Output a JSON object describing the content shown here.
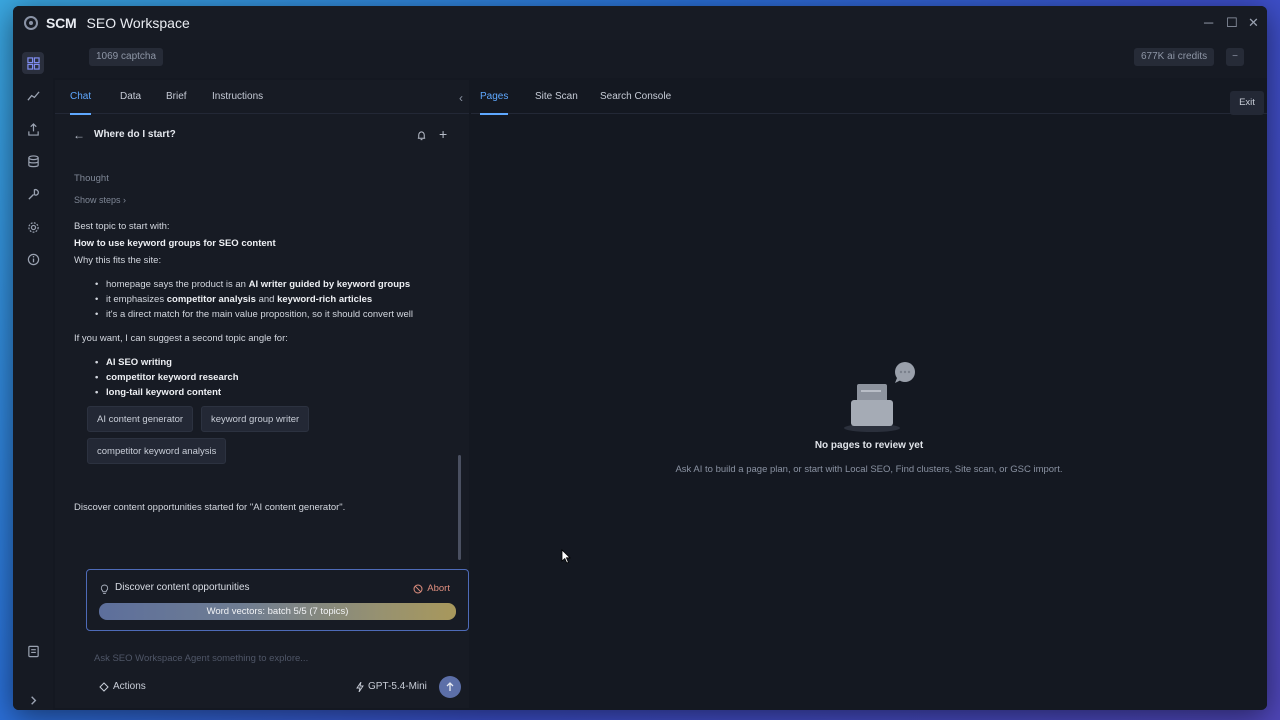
{
  "window": {
    "brand": "SCM",
    "title": "SEO Workspace"
  },
  "topbar": {
    "captcha": "1069 captcha",
    "credits": "677K ai credits",
    "credits_menu": "−"
  },
  "left": {
    "tabs": [
      "Chat",
      "Data",
      "Brief",
      "Instructions"
    ],
    "active_tab": "Chat",
    "conversation_title": "Where do I start?",
    "thought_label": "Thought",
    "show_steps": "Show steps",
    "intro": "Best topic to start with:",
    "topic": "How to use keyword groups for SEO content",
    "why": "Why this fits the site:",
    "reasons": [
      {
        "pre": "homepage says the product is an ",
        "bold": "AI writer guided by keyword groups",
        "post": ""
      },
      {
        "pre": "it emphasizes ",
        "bold": "competitor analysis",
        "mid": " and ",
        "bold2": "keyword-rich articles",
        "post": ""
      },
      {
        "pre": "it's a direct match for the main value proposition, so it should convert well",
        "bold": "",
        "post": ""
      }
    ],
    "second_angle": "If you want, I can suggest a second topic angle for:",
    "angles": [
      "AI SEO writing",
      "competitor keyword research",
      "long-tail keyword content"
    ],
    "chips": [
      "AI content generator",
      "keyword group writer",
      "competitor keyword analysis"
    ],
    "started_msg": "Discover content opportunities started for \"AI content generator\".",
    "task": {
      "name": "Discover content opportunities",
      "abort": "Abort",
      "progress_text": "Word vectors: batch 5/5 (7 topics)",
      "progress": 1.0
    },
    "input": {
      "placeholder": "Ask SEO Workspace Agent something to explore...",
      "actions": "Actions",
      "model": "GPT-5.4-Mini"
    }
  },
  "right": {
    "tabs": [
      "Pages",
      "Site Scan",
      "Search Console"
    ],
    "active_tab": "Pages",
    "exit": "Exit",
    "empty_title": "No pages to review yet",
    "empty_subtitle": "Ask AI to build a page plan, or start with Local SEO, Find clusters, Site scan, or GSC import."
  },
  "colors": {
    "accent": "#5fa8ff",
    "abort": "#e08f7f",
    "task_border": "#4e6bb8"
  }
}
